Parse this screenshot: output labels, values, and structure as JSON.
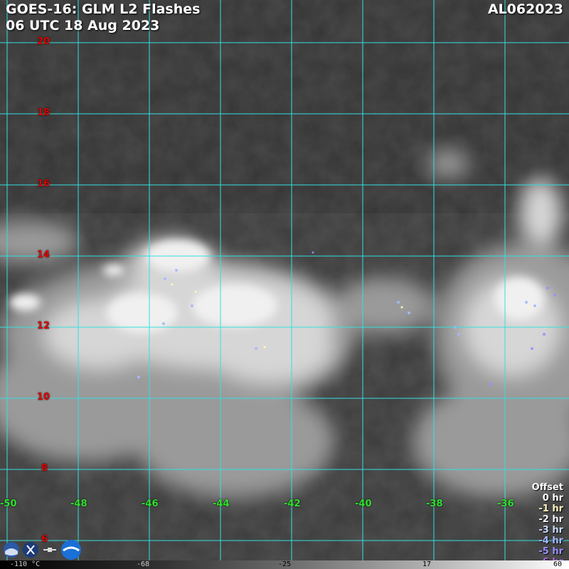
{
  "header": {
    "title_line1": "GOES-16: GLM L2 Flashes",
    "title_line2": "06 UTC 18 Aug 2023",
    "storm_id": "AL062023"
  },
  "grid": {
    "latitudes": [
      "20",
      "18",
      "16",
      "14",
      "12",
      "10",
      "8",
      "6"
    ],
    "longitudes": [
      "-50",
      "-48",
      "-46",
      "-44",
      "-42",
      "-40",
      "-38",
      "-36"
    ]
  },
  "legend": {
    "title": "Offset",
    "items": [
      {
        "label": "0 hr",
        "color": "#ffffff"
      },
      {
        "label": "-1 hr",
        "color": "#fff6c0"
      },
      {
        "label": "-2 hr",
        "color": "#f0f0ff"
      },
      {
        "label": "-3 hr",
        "color": "#c8d8ff"
      },
      {
        "label": "-4 hr",
        "color": "#a8b8ff"
      },
      {
        "label": "-5 hr",
        "color": "#9a90ff"
      },
      {
        "label": "-6 hr",
        "color": "#b070e0"
      }
    ]
  },
  "colorbar": {
    "labels": [
      "-110 °C",
      "-68",
      "-25",
      "17",
      "60"
    ]
  },
  "colors": {
    "grid_line": "#33e0e0",
    "lat_label": "#e00000",
    "lon_label": "#2ee02e"
  }
}
